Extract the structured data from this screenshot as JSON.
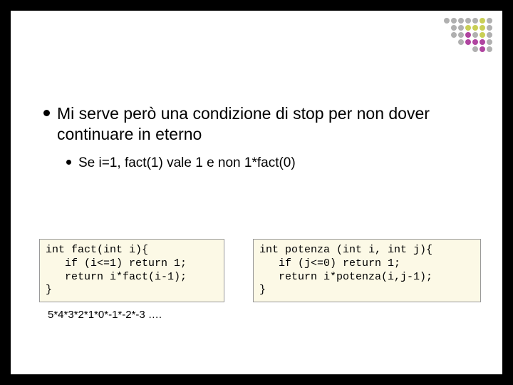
{
  "bullets": {
    "main": "Mi serve però una condizione di stop per non dover continuare in eterno",
    "sub": "Se i=1, fact(1) vale 1 e non 1*fact(0)"
  },
  "code": {
    "left": "int fact(int i){\n   if (i<=1) return 1;\n   return i*fact(i-1);\n}",
    "right": "int potenza (int i, int j){\n   if (j<=0) return 1;\n   return i*potenza(i,j-1);\n}"
  },
  "footnote": "5*4*3*2*1*0*-1*-2*-3 ….",
  "dots": {
    "r1": [
      "#b0b0b0",
      "#b0b0b0",
      "#b0b0b0",
      "#b0b0b0",
      "#b0b0b0",
      "#c9cf55",
      "#b0b0b0"
    ],
    "r2": [
      "#b0b0b0",
      "#b0b0b0",
      "#c9cf55",
      "#c9cf55",
      "#c9cf55",
      "#b0b0b0"
    ],
    "r3": [
      "#b0b0b0",
      "#b0b0b0",
      "#b044a0",
      "#b0b0b0",
      "#c9cf55",
      "#b0b0b0"
    ],
    "r4": [
      "#b0b0b0",
      "#b044a0",
      "#b044a0",
      "#b044a0",
      "#b0b0b0"
    ],
    "r5": [
      "#b0b0b0",
      "#b044a0",
      "#b0b0b0"
    ]
  }
}
